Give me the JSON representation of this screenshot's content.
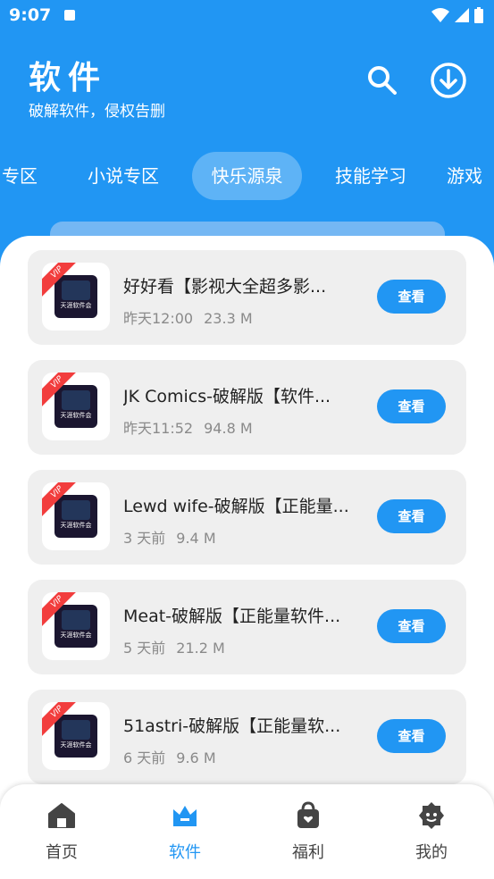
{
  "status_bar": {
    "time": "9:07"
  },
  "header": {
    "title": "软件",
    "subtitle": "破解软件，侵权告删"
  },
  "tabs": [
    {
      "label": "专区"
    },
    {
      "label": "小说专区"
    },
    {
      "label": "快乐源泉",
      "active": true
    },
    {
      "label": "技能学习"
    },
    {
      "label": "游戏"
    }
  ],
  "icon_badge": {
    "vip": "VIP",
    "logo_text": "天涯软件会"
  },
  "items": [
    {
      "title": "好好看【影视大全超多影...",
      "time": "昨天12:00",
      "size": "23.3 M",
      "button": "查看"
    },
    {
      "title": "JK Comics-破解版【软件...",
      "time": "昨天11:52",
      "size": "94.8 M",
      "button": "查看"
    },
    {
      "title": "Lewd wife-破解版【正能量...",
      "time": "3 天前",
      "size": "9.4 M",
      "button": "查看"
    },
    {
      "title": "Meat-破解版【正能量软件...",
      "time": "5 天前",
      "size": "21.2 M",
      "button": "查看"
    },
    {
      "title": "51astri-破解版【正能量软...",
      "time": "6 天前",
      "size": "9.6 M",
      "button": "查看"
    }
  ],
  "bottom_nav": [
    {
      "label": "首页",
      "icon": "home-icon"
    },
    {
      "label": "软件",
      "icon": "crown-icon",
      "active": true
    },
    {
      "label": "福利",
      "icon": "gift-bag-icon"
    },
    {
      "label": "我的",
      "icon": "profile-icon"
    }
  ],
  "colors": {
    "primary": "#2196f3",
    "card": "#efefef",
    "vip": "#f23d3d"
  }
}
